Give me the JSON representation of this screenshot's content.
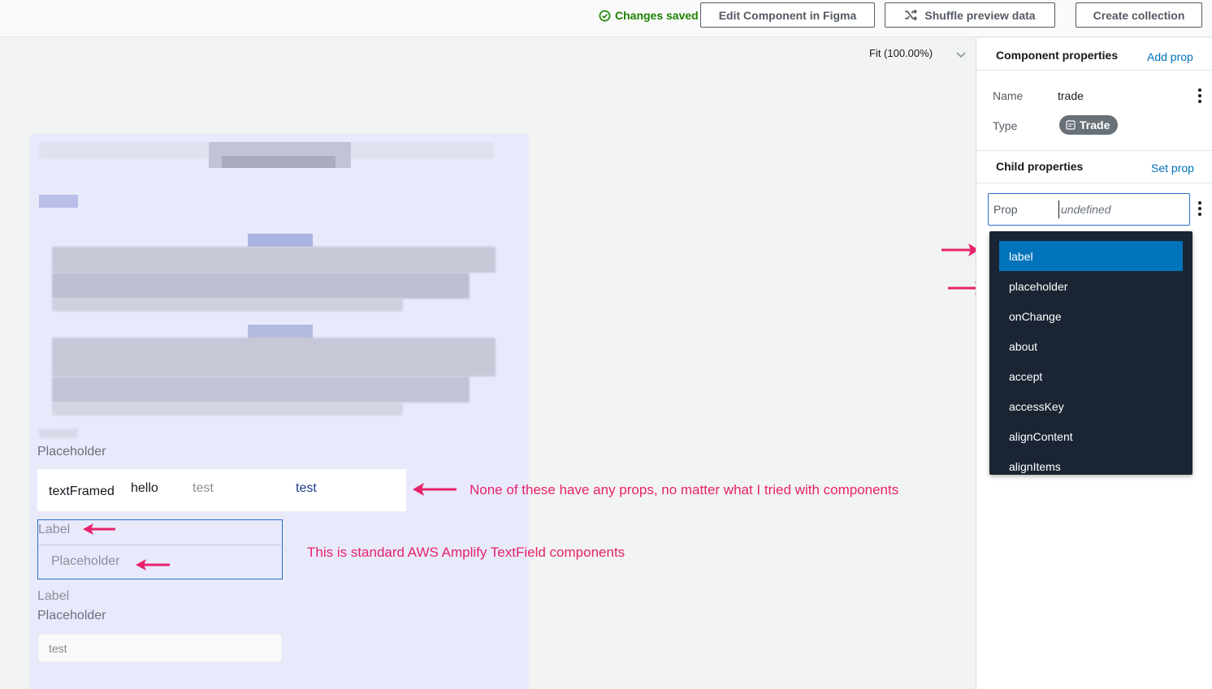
{
  "topbar": {
    "status": "Changes saved",
    "edit_figma": "Edit Component in Figma",
    "shuffle": "Shuffle preview data",
    "create_collection": "Create collection",
    "colors": {
      "success": "#1d8102",
      "button_text": "#545b64"
    }
  },
  "canvas": {
    "zoom": "Fit (100.00%)",
    "preview": {
      "placeholder1": "Placeholder",
      "row": {
        "textframed": "textFramed",
        "hello": "hello",
        "test_gray": "test",
        "test_blue": "test"
      },
      "textfield": {
        "label": "Label",
        "placeholder": "Placeholder"
      },
      "label2": "Label",
      "placeholder2": "Placeholder",
      "test_input": "test"
    },
    "annotations": {
      "note1": "None of these have any props, no matter what I tried with components",
      "note2": "This is standard AWS Amplify TextField components",
      "color": "#e8226a"
    }
  },
  "panel": {
    "component_properties": {
      "title": "Component properties",
      "add_link": "Add prop",
      "name_label": "Name",
      "name_value": "trade",
      "type_label": "Type",
      "type_value": "Trade"
    },
    "child_properties": {
      "title": "Child properties",
      "set_link": "Set prop",
      "prop_label": "Prop",
      "prop_placeholder": "undefined"
    },
    "dropdown": {
      "items": [
        "label",
        "placeholder",
        "onChange",
        "about",
        "accept",
        "accessKey",
        "alignContent",
        "alignItems"
      ],
      "selected": "label",
      "accent": "#0073bb"
    }
  }
}
